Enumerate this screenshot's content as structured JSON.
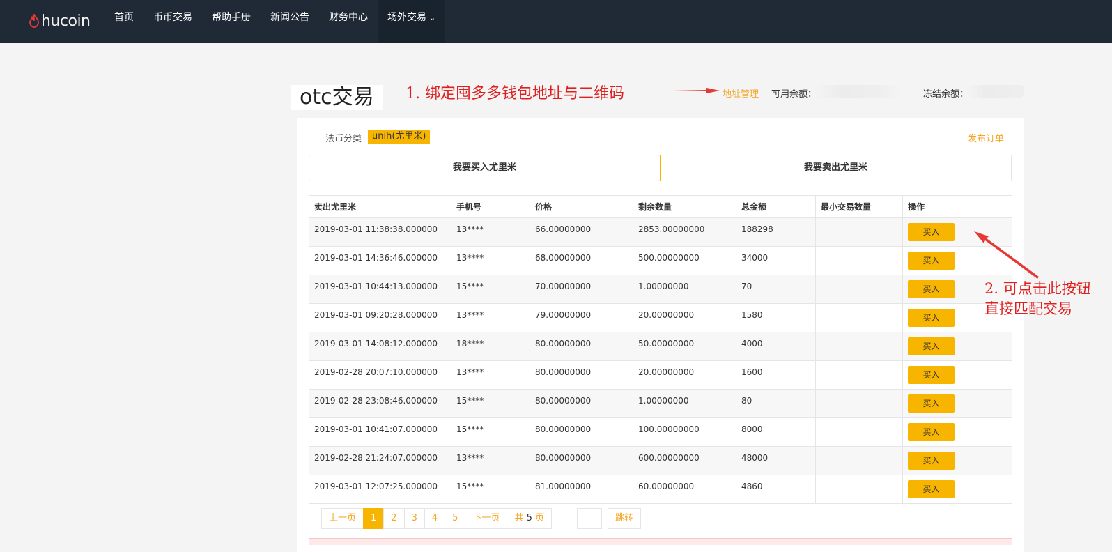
{
  "brand": {
    "logo_text": "hucoin"
  },
  "nav": {
    "items": [
      {
        "label": "首页"
      },
      {
        "label": "币币交易"
      },
      {
        "label": "帮助手册"
      },
      {
        "label": "新闻公告"
      },
      {
        "label": "财务中心"
      },
      {
        "label": "场外交易"
      }
    ]
  },
  "header": {
    "title": "otc交易",
    "address_manage": "地址管理",
    "available_label": "可用余额：",
    "frozen_label": "冻结余额："
  },
  "annotations": {
    "note1": "1. 绑定囤多多钱包地址与二维码",
    "note2_line1": "2. 可点击此按钮",
    "note2_line2": "直接匹配交易"
  },
  "filter": {
    "label": "法币分类",
    "selected": "unih(尤里米)",
    "publish": "发布订单"
  },
  "tabs": [
    {
      "label": "我要买入尤里米"
    },
    {
      "label": "我要卖出尤里米"
    }
  ],
  "table": {
    "headers": [
      "卖出尤里米",
      "手机号",
      "价格",
      "剩余数量",
      "总金额",
      "最小交易数量",
      "操作"
    ],
    "action_label": "买入",
    "rows": [
      [
        "2019-03-01 11:38:38.000000",
        "13****",
        "66.00000000",
        "2853.00000000",
        "188298",
        ""
      ],
      [
        "2019-03-01 14:36:46.000000",
        "13****",
        "68.00000000",
        "500.00000000",
        "34000",
        ""
      ],
      [
        "2019-03-01 10:44:13.000000",
        "15****",
        "70.00000000",
        "1.00000000",
        "70",
        ""
      ],
      [
        "2019-03-01 09:20:28.000000",
        "13****",
        "79.00000000",
        "20.00000000",
        "1580",
        ""
      ],
      [
        "2019-03-01 14:08:12.000000",
        "18****",
        "80.00000000",
        "50.00000000",
        "4000",
        ""
      ],
      [
        "2019-02-28 20:07:10.000000",
        "13****",
        "80.00000000",
        "20.00000000",
        "1600",
        ""
      ],
      [
        "2019-02-28 23:08:46.000000",
        "15****",
        "80.00000000",
        "1.00000000",
        "80",
        ""
      ],
      [
        "2019-03-01 10:41:07.000000",
        "15****",
        "80.00000000",
        "100.00000000",
        "8000",
        ""
      ],
      [
        "2019-02-28 21:24:07.000000",
        "13****",
        "80.00000000",
        "600.00000000",
        "48000",
        ""
      ],
      [
        "2019-03-01 12:07:25.000000",
        "15****",
        "81.00000000",
        "60.00000000",
        "4860",
        ""
      ]
    ]
  },
  "pagination": {
    "prev": "上一页",
    "pages": [
      "1",
      "2",
      "3",
      "4",
      "5"
    ],
    "current": "1",
    "next": "下一页",
    "total_prefix": "共",
    "total_pages": "5",
    "total_suffix": "页",
    "jump": "跳转"
  },
  "colors": {
    "accent": "#f7b500",
    "link": "#f5a623",
    "nav_bg": "#1f2a36",
    "annotation": "#e02020"
  }
}
